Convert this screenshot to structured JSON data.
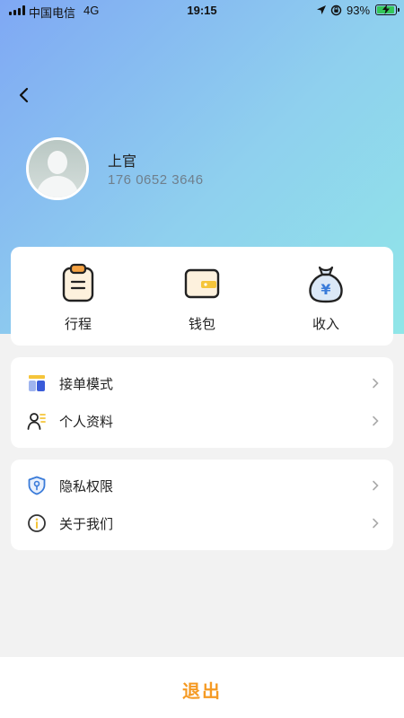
{
  "status_bar": {
    "carrier": "中国电信",
    "network": "4G",
    "time": "19:15",
    "battery_percent": "93%",
    "battery_level": 0.93
  },
  "profile": {
    "name": "上官",
    "phone": "176 0652 3646"
  },
  "quick_actions": [
    {
      "label": "行程",
      "icon": "clipboard-icon"
    },
    {
      "label": "钱包",
      "icon": "wallet-icon"
    },
    {
      "label": "收入",
      "icon": "money-bag-icon"
    }
  ],
  "menu_group_1": [
    {
      "label": "接单模式",
      "icon": "order-mode-icon"
    },
    {
      "label": "个人资料",
      "icon": "profile-icon"
    }
  ],
  "menu_group_2": [
    {
      "label": "隐私权限",
      "icon": "shield-icon"
    },
    {
      "label": "关于我们",
      "icon": "info-icon"
    }
  ],
  "logout": {
    "label": "退出"
  },
  "colors": {
    "accent": "#f59a23",
    "gradient_start": "#7fa8f4",
    "gradient_end": "#90e6e8",
    "icon_blue": "#3a5bd9",
    "icon_yellow": "#f5c53a"
  }
}
